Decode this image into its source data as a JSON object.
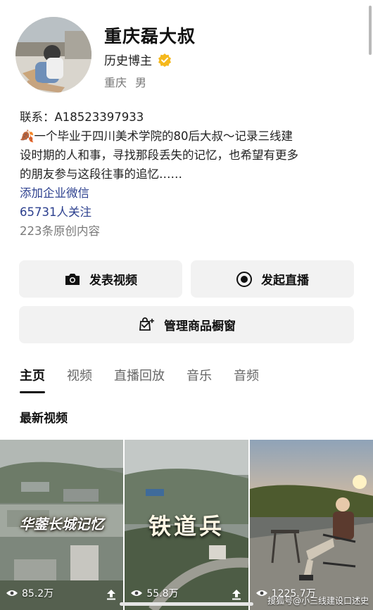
{
  "profile": {
    "name": "重庆磊大叔",
    "title": "历史博主",
    "location": "重庆",
    "gender": "男"
  },
  "bio": {
    "contact": "联系：A18523397933",
    "line1": "🍂一个毕业于四川美术学院的80后大叔～记录三线建",
    "line2": "设时期的人和事，寻找那段丢失的记忆，也希望有更多",
    "line3": "的朋友参与这段往事的追忆……",
    "add_wechat": "添加企业微信",
    "followers": "65731人关注",
    "original_count": "223条原创内容"
  },
  "buttons": {
    "publish_video": "发表视频",
    "start_live": "发起直播",
    "manage_shop": "管理商品橱窗"
  },
  "tabs": [
    "主页",
    "视频",
    "直播回放",
    "音乐",
    "音频"
  ],
  "section": {
    "latest_videos": "最新视频"
  },
  "videos": [
    {
      "overlay_text": "华蓥长城记忆",
      "views": "85.2万"
    },
    {
      "overlay_text": "铁道兵",
      "views": "55.8万"
    },
    {
      "overlay_text": "",
      "views": "1225.7万"
    }
  ],
  "watermark": "搜狐号@小三线建设口述史",
  "colors": {
    "link": "#2b3f8e",
    "verify": "#f5b81c",
    "button_bg": "#f2f2f2"
  }
}
